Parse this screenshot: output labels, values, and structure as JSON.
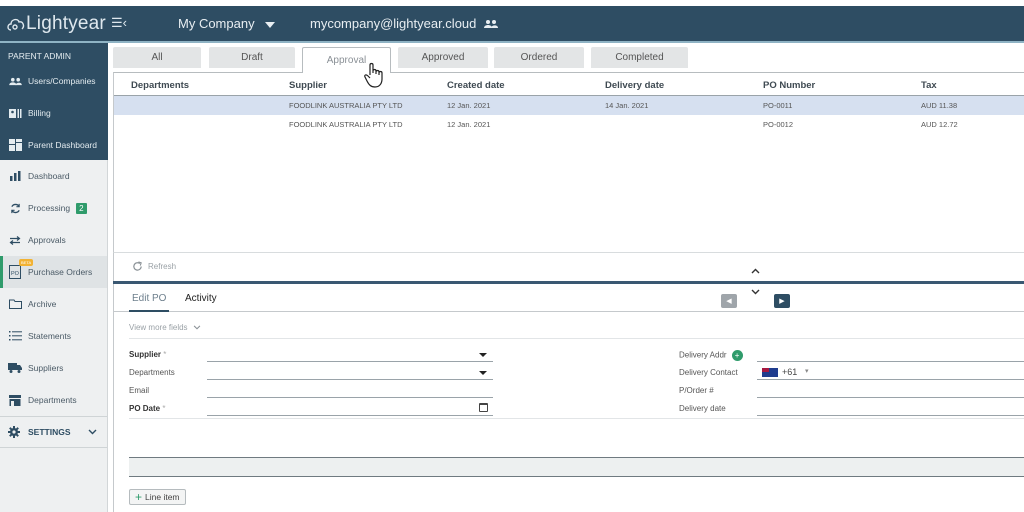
{
  "header": {
    "logo_text": "Lightyear",
    "company_label": "My Company",
    "user_email": "mycompany@lightyear.cloud",
    "icons": {
      "menu": "menu-collapse-icon",
      "company_dropdown": "caret-down-icon",
      "user": "users-icon"
    }
  },
  "sidebar": {
    "admin_title": "PARENT ADMIN",
    "admin_items": [
      {
        "label": "Users/Companies",
        "icon": "users-icon"
      },
      {
        "label": "Billing",
        "icon": "billing-icon"
      },
      {
        "label": "Parent Dashboard",
        "icon": "dashboard-grid-icon"
      }
    ],
    "items": [
      {
        "label": "Dashboard",
        "icon": "bar-chart-icon"
      },
      {
        "label": "Processing",
        "icon": "sync-icon",
        "badge": "2"
      },
      {
        "label": "Approvals",
        "icon": "swap-arrows-icon"
      },
      {
        "label": "Purchase Orders",
        "icon": "po-document-icon",
        "tag": "BETA",
        "active": true
      },
      {
        "label": "Archive",
        "icon": "folder-icon"
      },
      {
        "label": "Statements",
        "icon": "list-icon"
      },
      {
        "label": "Suppliers",
        "icon": "truck-icon"
      },
      {
        "label": "Departments",
        "icon": "store-icon"
      }
    ],
    "settings_label": "SETTINGS"
  },
  "tabs": [
    {
      "label": "All"
    },
    {
      "label": "Draft"
    },
    {
      "label": "Approval",
      "active": true
    },
    {
      "label": "Approved"
    },
    {
      "label": "Ordered"
    },
    {
      "label": "Completed"
    }
  ],
  "table": {
    "columns": [
      "Departments",
      "Supplier",
      "Created date",
      "Delivery date",
      "PO Number",
      "Tax"
    ],
    "rows": [
      {
        "department": "",
        "supplier": "FOODLINK AUSTRALIA PTY LTD",
        "created": "12 Jan. 2021",
        "delivery": "14 Jan. 2021",
        "po_number": "PO-0011",
        "tax": "AUD 11.38",
        "selected": true
      },
      {
        "department": "",
        "supplier": "FOODLINK AUSTRALIA PTY LTD",
        "created": "12 Jan. 2021",
        "delivery": "",
        "po_number": "PO-0012",
        "tax": "AUD 12.72",
        "selected": false
      }
    ]
  },
  "refresh_label": "Refresh",
  "edit": {
    "subtabs": [
      {
        "label": "Edit PO",
        "active": true
      },
      {
        "label": "Activity"
      }
    ],
    "view_more": "View more fields",
    "left_fields": [
      {
        "label": "Supplier",
        "required": true,
        "value": "",
        "type": "select"
      },
      {
        "label": "Departments",
        "required": false,
        "value": "",
        "type": "select"
      },
      {
        "label": "Email",
        "required": false,
        "value": "",
        "type": "text"
      },
      {
        "label": "PO Date",
        "required": true,
        "value": "",
        "type": "date"
      }
    ],
    "right_fields": [
      {
        "label": "Delivery Addr",
        "value": ""
      },
      {
        "label": "Delivery Contact",
        "value": "",
        "country_code": "+61"
      },
      {
        "label": "P/Order #",
        "value": ""
      },
      {
        "label": "Delivery date",
        "value": ""
      }
    ],
    "required_mark": "*",
    "line_item_label": "Line item"
  },
  "colors": {
    "brand_dark": "#2e4d63",
    "accent_green": "#2f9b6b",
    "selected_row": "#d6e0f0"
  }
}
